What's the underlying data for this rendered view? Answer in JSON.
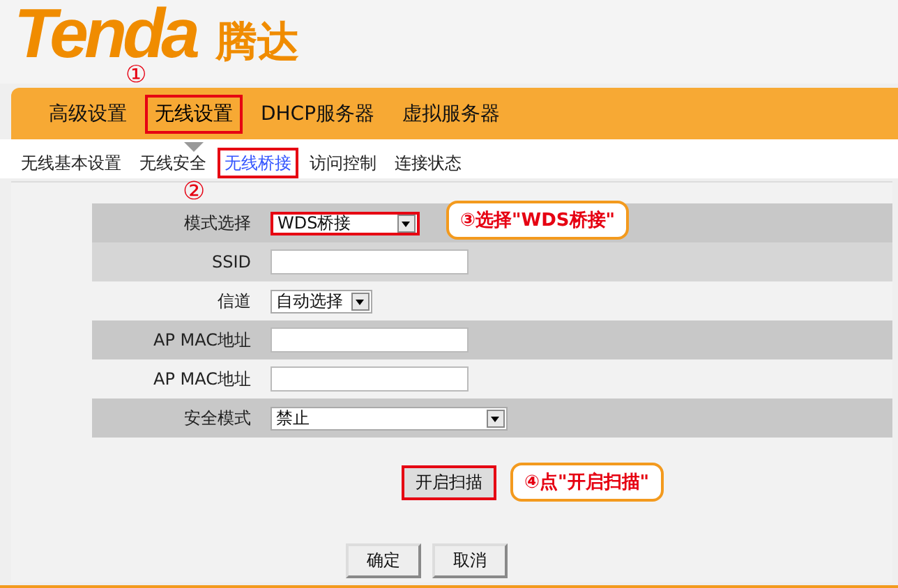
{
  "logo": {
    "brand": "Tenda",
    "name": "腾达"
  },
  "tabs": [
    {
      "label": "高级设置",
      "selected": false,
      "marked": false
    },
    {
      "label": "无线设置",
      "selected": true,
      "marked": true
    },
    {
      "label": "DHCP服务器",
      "selected": false,
      "marked": false
    },
    {
      "label": "虚拟服务器",
      "selected": false,
      "marked": false
    }
  ],
  "subtabs": [
    {
      "label": "无线基本设置",
      "selected": false,
      "marked": false
    },
    {
      "label": "无线安全",
      "selected": false,
      "marked": false
    },
    {
      "label": "无线桥接",
      "selected": true,
      "marked": true
    },
    {
      "label": "访问控制",
      "selected": false,
      "marked": false
    },
    {
      "label": "连接状态",
      "selected": false,
      "marked": false
    }
  ],
  "form": [
    {
      "kind": "select",
      "label": "模式选择",
      "value": "WDS桥接",
      "marked": true
    },
    {
      "kind": "input",
      "label": "SSID"
    },
    {
      "kind": "select",
      "label": "信道",
      "value": "自动选择",
      "marked": false
    },
    {
      "kind": "input",
      "label": "AP MAC地址"
    },
    {
      "kind": "input",
      "label": "AP MAC地址"
    },
    {
      "kind": "select",
      "label": "安全模式",
      "value": "禁止",
      "marked": false
    }
  ],
  "scan_button": {
    "label": "开启扫描",
    "marked": true
  },
  "buttons": [
    "确定",
    "取消"
  ],
  "annotations": [
    {
      "kind": "number",
      "text": "①"
    },
    {
      "kind": "number",
      "text": "②"
    },
    {
      "kind": "callout",
      "text": "③选择\"WDS桥接\""
    },
    {
      "kind": "callout",
      "text": "④点\"开启扫描\""
    }
  ]
}
